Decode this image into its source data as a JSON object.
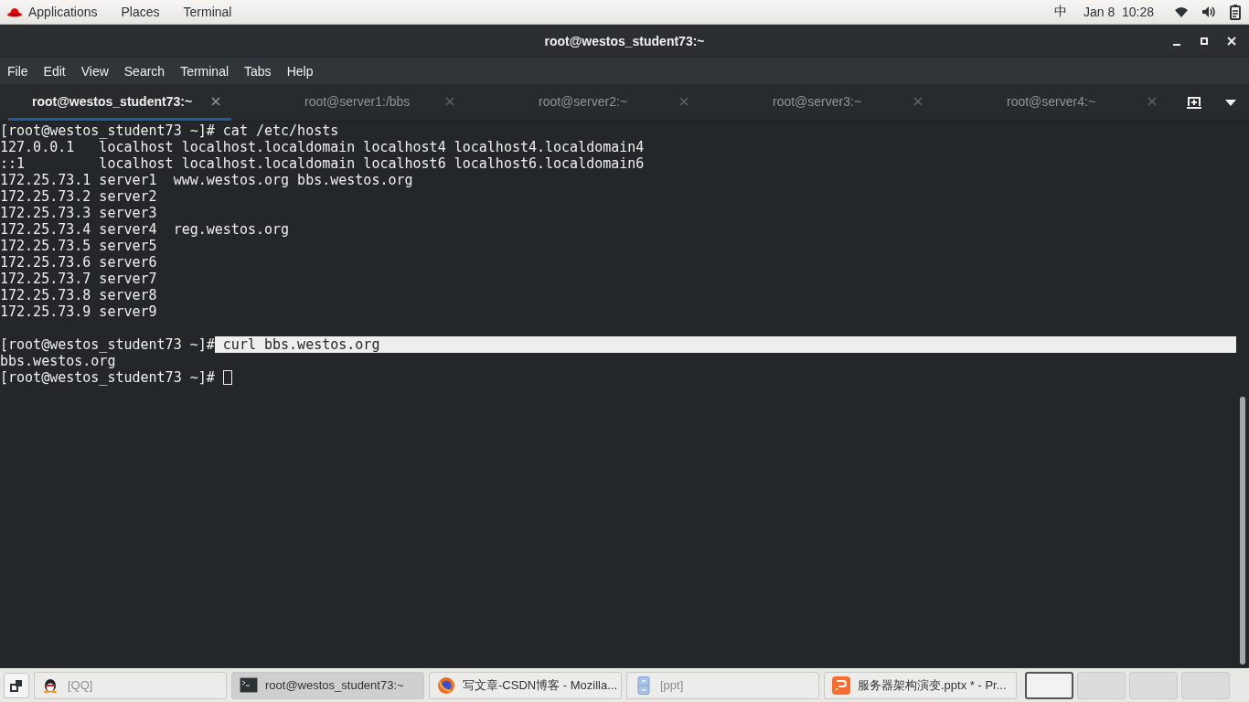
{
  "top_bar": {
    "menus": [
      "Applications",
      "Places",
      "Terminal"
    ],
    "input_method": "中",
    "clock": "Jan 8  10:28"
  },
  "window": {
    "title": "root@westos_student73:~",
    "menu": [
      "File",
      "Edit",
      "View",
      "Search",
      "Terminal",
      "Tabs",
      "Help"
    ],
    "tabs": [
      {
        "label": "root@westos_student73:~",
        "selected": true
      },
      {
        "label": "root@server1:/bbs",
        "selected": false
      },
      {
        "label": "root@server2:~",
        "selected": false
      },
      {
        "label": "root@server3:~",
        "selected": false
      },
      {
        "label": "root@server4:~",
        "selected": false
      }
    ],
    "terminal_lines": [
      {
        "kind": "text",
        "text": "[root@westos_student73 ~]# cat /etc/hosts",
        "cursor": false
      },
      {
        "kind": "text",
        "text": "127.0.0.1   localhost localhost.localdomain localhost4 localhost4.localdomain4",
        "cursor": false
      },
      {
        "kind": "text",
        "text": "::1         localhost localhost.localdomain localhost6 localhost6.localdomain6",
        "cursor": false
      },
      {
        "kind": "text",
        "text": "172.25.73.1 server1  www.westos.org bbs.westos.org",
        "cursor": false
      },
      {
        "kind": "text",
        "text": "172.25.73.2 server2",
        "cursor": false
      },
      {
        "kind": "text",
        "text": "172.25.73.3 server3",
        "cursor": false
      },
      {
        "kind": "text",
        "text": "172.25.73.4 server4  reg.westos.org",
        "cursor": false
      },
      {
        "kind": "text",
        "text": "172.25.73.5 server5",
        "cursor": false
      },
      {
        "kind": "text",
        "text": "172.25.73.6 server6",
        "cursor": false
      },
      {
        "kind": "text",
        "text": "172.25.73.7 server7",
        "cursor": false
      },
      {
        "kind": "text",
        "text": "172.25.73.8 server8",
        "cursor": false
      },
      {
        "kind": "text",
        "text": "172.25.73.9 server9",
        "cursor": false
      },
      {
        "kind": "blank"
      },
      {
        "kind": "text",
        "text": "[root@westos_student73 ~]#",
        "selected_text": " curl bbs.westos.org",
        "cursor": false
      },
      {
        "kind": "text",
        "text": "bbs.westos.org",
        "cursor": false
      },
      {
        "kind": "text",
        "text": "[root@westos_student73 ~]# ",
        "cursor": true
      }
    ]
  },
  "taskbar": [
    {
      "kind": "qq",
      "label": "[QQ]",
      "selected": false
    },
    {
      "kind": "terminal",
      "label": "root@westos_student73:~",
      "selected": true
    },
    {
      "kind": "firefox",
      "label": "写文章-CSDN博客 - Mozilla...",
      "selected": false
    },
    {
      "kind": "files",
      "label": "[ppt]",
      "selected": false
    },
    {
      "kind": "wps",
      "label": "服务器架构演变.pptx * - Pr...",
      "selected": false
    }
  ]
}
